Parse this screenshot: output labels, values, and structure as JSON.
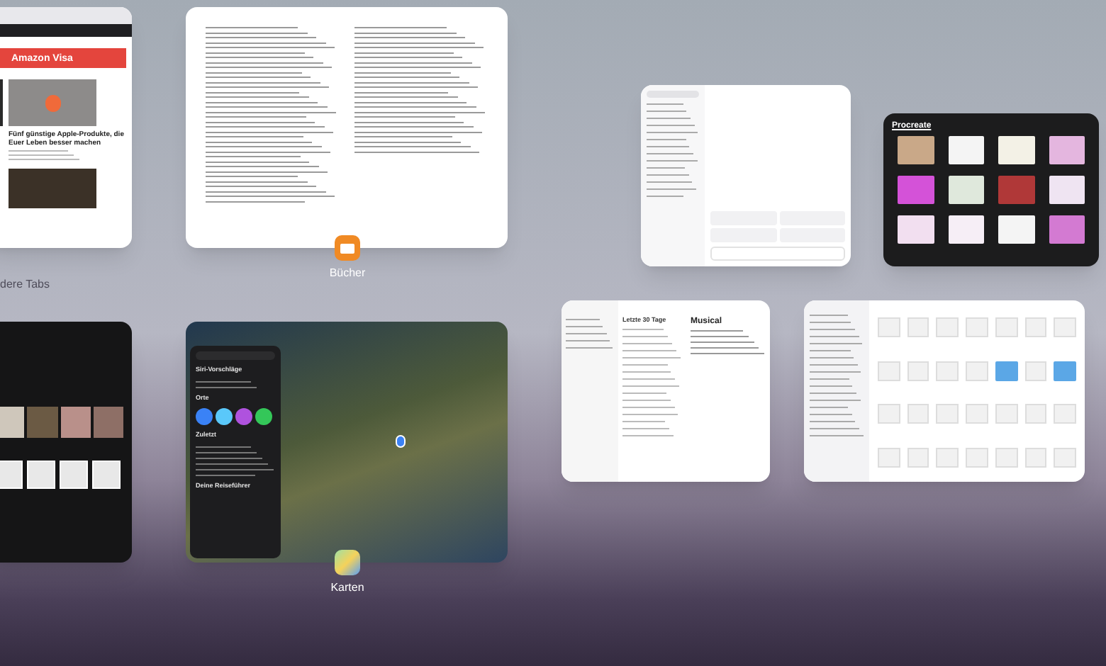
{
  "windows": [
    {
      "kind": "browser",
      "banner": "Amazon Visa",
      "headline": "Fünf günstige Apple-Produkte, die Euer Leben besser machen",
      "caption": "dere Tabs"
    },
    {
      "kind": "reader",
      "app_label": "Bücher"
    },
    {
      "kind": "chat"
    },
    {
      "kind": "gallery",
      "title": "Procreate"
    },
    {
      "kind": "photos"
    },
    {
      "kind": "maps",
      "app_label": "Karten",
      "sections": [
        "Siri-Vorschläge",
        "Orte",
        "Zuletzt",
        "Deine Reiseführer"
      ]
    },
    {
      "kind": "notes",
      "list_heading": "Letzte 30 Tage",
      "note_title": "Musical"
    },
    {
      "kind": "files"
    }
  ]
}
